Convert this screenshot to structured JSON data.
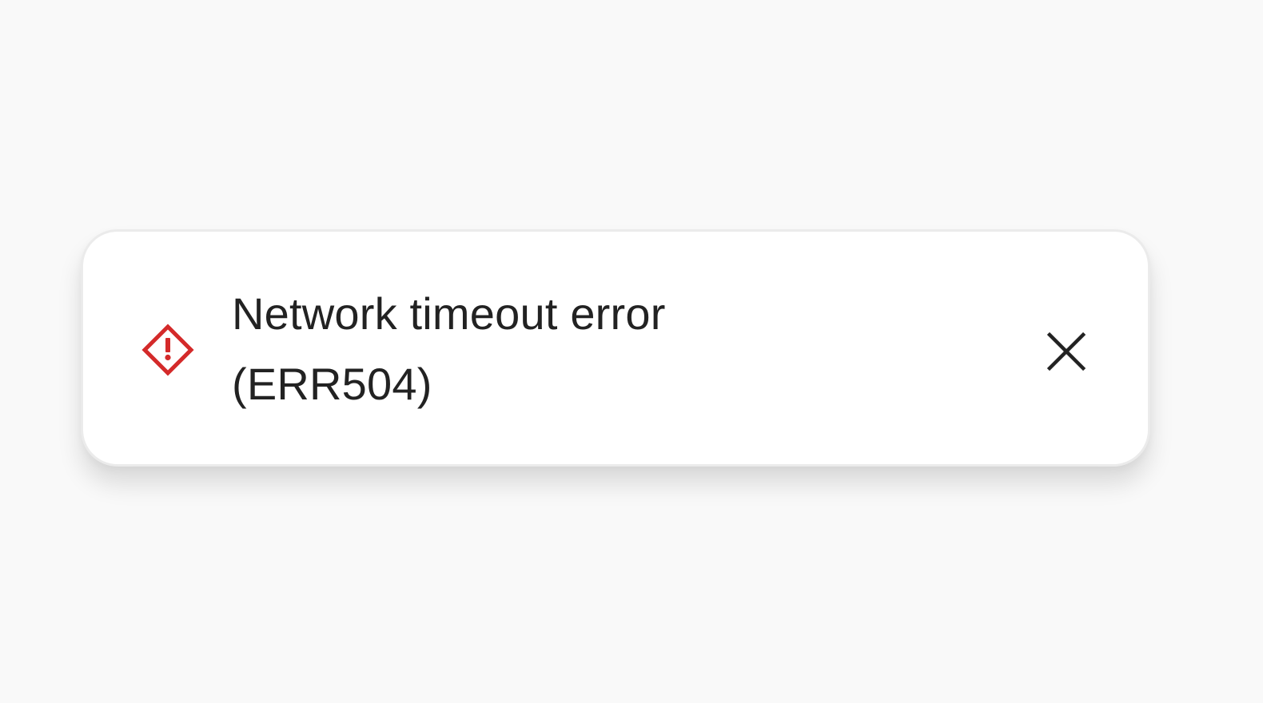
{
  "toast": {
    "message": "Network timeout error (ERR504)",
    "severity_icon": "warning-diamond-icon",
    "dismiss_icon": "close-icon"
  },
  "colors": {
    "background": "#f9f9f9",
    "card": "#ffffff",
    "card_border": "#ebebeb",
    "error_accent": "#d42a2a",
    "text": "#222222"
  }
}
